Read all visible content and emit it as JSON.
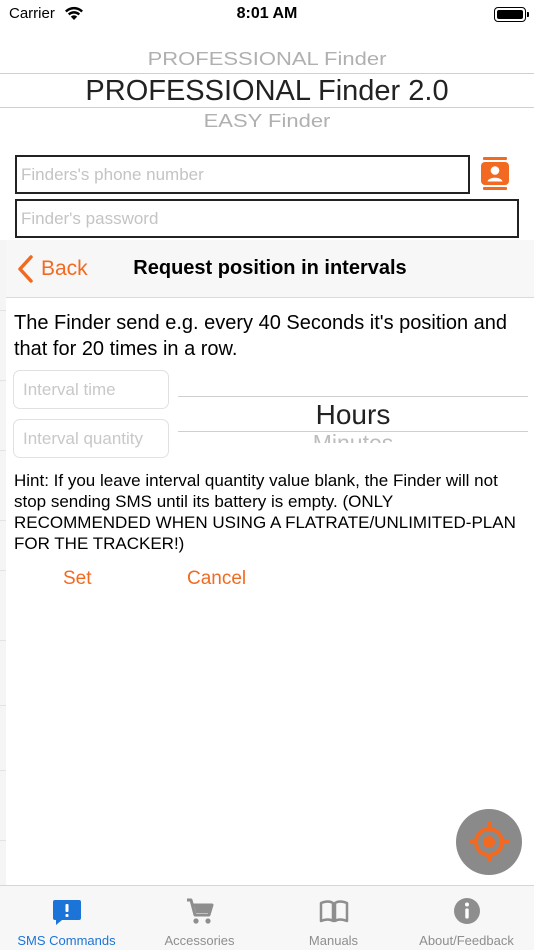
{
  "status_bar": {
    "carrier": "Carrier",
    "time": "8:01 AM"
  },
  "model_picker": {
    "previous": "PROFESSIONAL Finder",
    "selected": "PROFESSIONAL Finder 2.0",
    "next": "EASY Finder"
  },
  "fields": {
    "phone_placeholder": "Finders's phone number",
    "password_placeholder": "Finder's password"
  },
  "modal": {
    "back_label": "Back",
    "title": "Request position in intervals",
    "description": "The Finder send e.g. every 40 Seconds it's position and that for 20 times in a row.",
    "interval_time_placeholder": "Interval time",
    "interval_quantity_placeholder": "Interval quantity",
    "unit_picker": {
      "selected": "Hours",
      "next": "Minutes"
    },
    "hint": "Hint: If you leave interval quantity value blank, the Finder will not stop sending SMS until its battery is empty. (ONLY RECOMMENDED WHEN USING A FLATRATE/UNLIMITED-PLAN FOR THE TRACKER!)",
    "set_label": "Set",
    "cancel_label": "Cancel"
  },
  "tab_bar": {
    "items": [
      {
        "label": "SMS Commands",
        "icon": "sms-icon",
        "active": true
      },
      {
        "label": "Accessories",
        "icon": "cart-icon",
        "active": false
      },
      {
        "label": "Manuals",
        "icon": "book-icon",
        "active": false
      },
      {
        "label": "About/Feedback",
        "icon": "info-icon",
        "active": false
      }
    ]
  },
  "colors": {
    "accent": "#f26a21",
    "tab_active": "#1d74d8",
    "tab_inactive": "#8e8e8e"
  }
}
